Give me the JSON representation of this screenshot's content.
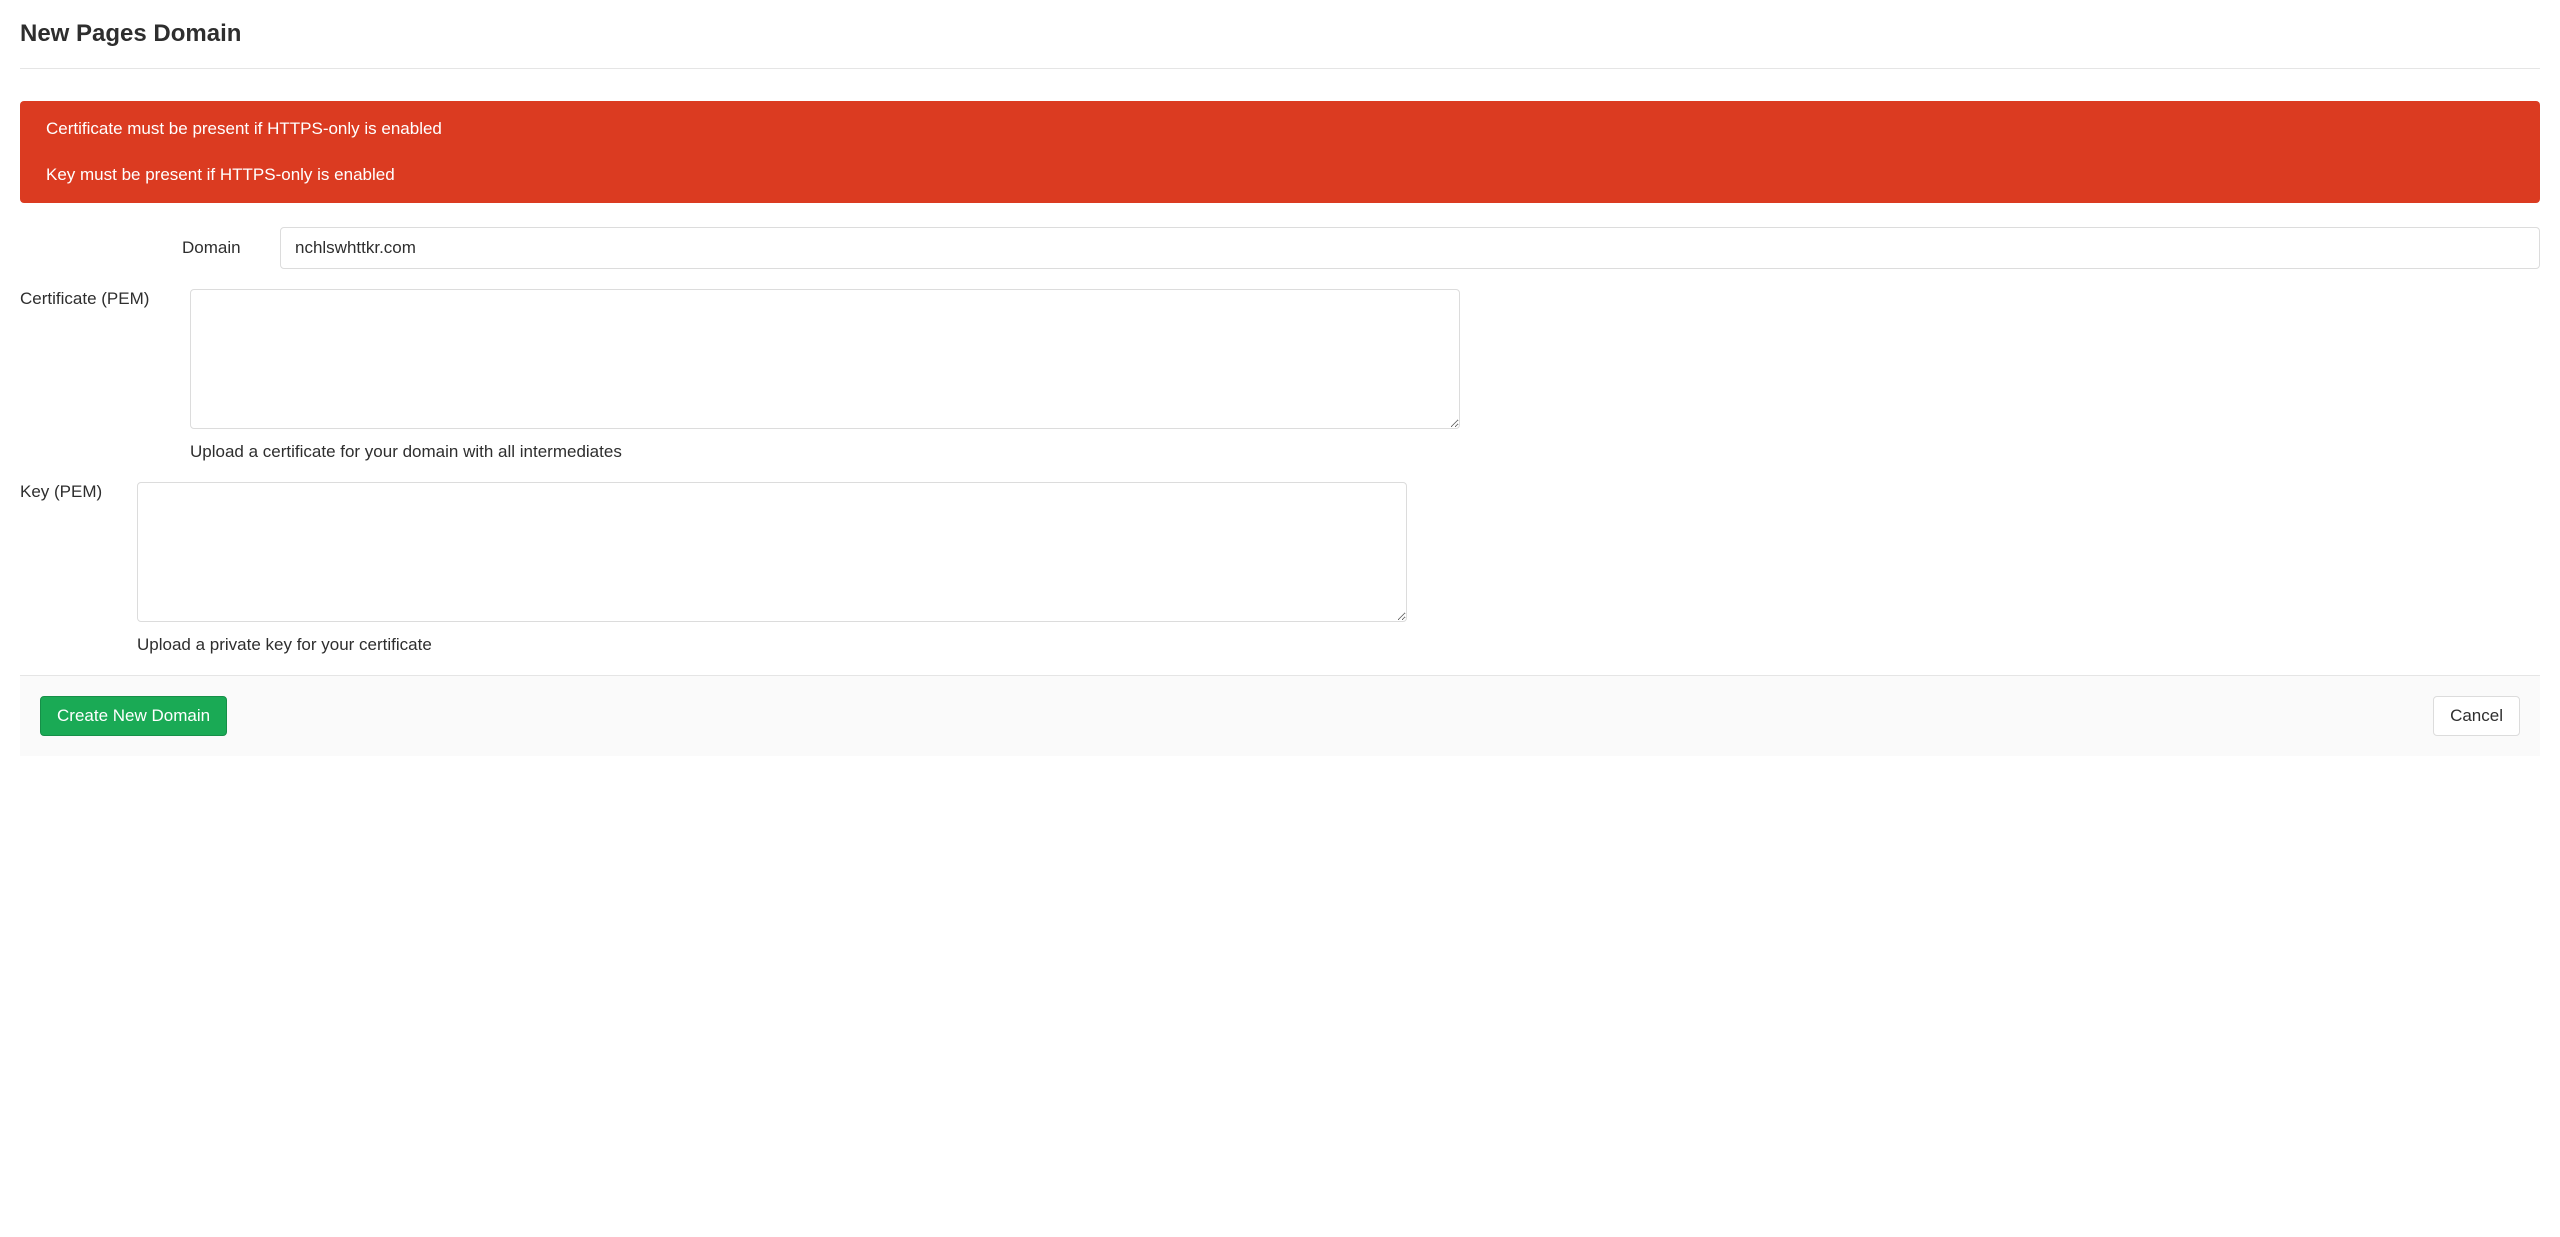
{
  "page": {
    "title": "New Pages Domain"
  },
  "alert": {
    "messages": [
      "Certificate must be present if HTTPS-only is enabled",
      "Key must be present if HTTPS-only is enabled"
    ]
  },
  "form": {
    "domain": {
      "label": "Domain",
      "value": "nchlswhttkr.com"
    },
    "certificate": {
      "label": "Certificate (PEM)",
      "value": "",
      "help": "Upload a certificate for your domain with all intermediates"
    },
    "key": {
      "label": "Key (PEM)",
      "value": "",
      "help": "Upload a private key for your certificate"
    }
  },
  "actions": {
    "submit": "Create New Domain",
    "cancel": "Cancel"
  }
}
